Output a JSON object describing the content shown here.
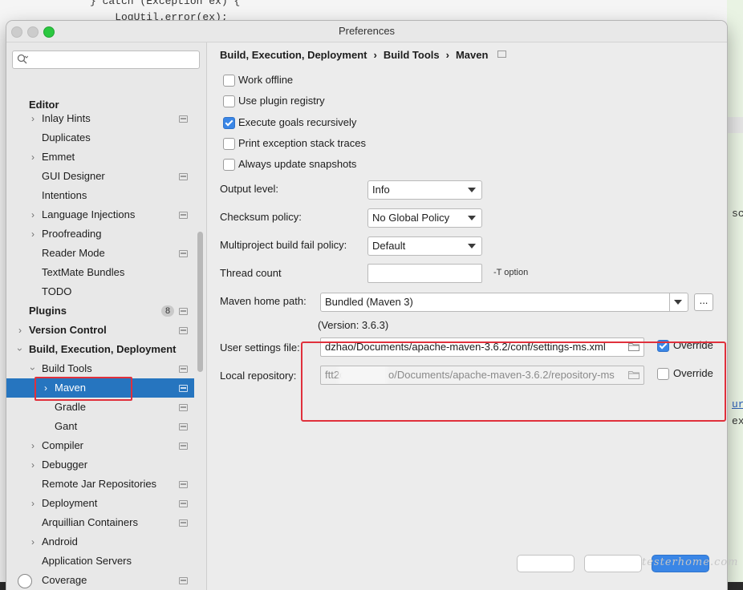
{
  "background_code": {
    "line1": "} catch (Exception ex) {",
    "line2": "    LogUtil.error(ex);",
    "right_text_1": "sc",
    "right_text_2": "ex",
    "right_link": "ur"
  },
  "window": {
    "title": "Preferences"
  },
  "search": {
    "placeholder": "",
    "value": ""
  },
  "sidebar": {
    "section_editor": "Editor",
    "items": [
      {
        "label": "Inlay Hints"
      },
      {
        "label": "Duplicates"
      },
      {
        "label": "Emmet"
      },
      {
        "label": "GUI Designer"
      },
      {
        "label": "Intentions"
      },
      {
        "label": "Language Injections"
      },
      {
        "label": "Proofreading"
      },
      {
        "label": "Reader Mode"
      },
      {
        "label": "TextMate Bundles"
      },
      {
        "label": "TODO"
      },
      {
        "label": "Plugins",
        "badge": "8"
      },
      {
        "label": "Version Control"
      },
      {
        "label": "Build, Execution, Deployment"
      },
      {
        "label": "Build Tools"
      },
      {
        "label": "Maven"
      },
      {
        "label": "Gradle"
      },
      {
        "label": "Gant"
      },
      {
        "label": "Compiler"
      },
      {
        "label": "Debugger"
      },
      {
        "label": "Remote Jar Repositories"
      },
      {
        "label": "Deployment"
      },
      {
        "label": "Arquillian Containers"
      },
      {
        "label": "Android"
      },
      {
        "label": "Application Servers"
      },
      {
        "label": "Coverage"
      }
    ]
  },
  "breadcrumb": [
    "Build, Execution, Deployment",
    "Build Tools",
    "Maven"
  ],
  "checkboxes": [
    {
      "label": "Work offline",
      "checked": false
    },
    {
      "label": "Use plugin registry",
      "checked": false
    },
    {
      "label": "Execute goals recursively",
      "checked": true
    },
    {
      "label": "Print exception stack traces",
      "checked": false
    },
    {
      "label": "Always update snapshots",
      "checked": false
    }
  ],
  "fields": {
    "output_level": {
      "label": "Output level:",
      "value": "Info"
    },
    "checksum_policy": {
      "label": "Checksum policy:",
      "value": "No Global Policy"
    },
    "fail_policy": {
      "label": "Multiproject build fail policy:",
      "value": "Default"
    },
    "thread_count": {
      "label": "Thread count",
      "value": "",
      "hint": "-T option"
    },
    "maven_home": {
      "label": "Maven home path:",
      "value": "Bundled (Maven 3)",
      "browse": "...",
      "version": "(Version: 3.6.3)"
    },
    "user_settings": {
      "label": "User settings file:",
      "value": "dzhao/Documents/apache-maven-3.6.2/conf/settings-ms.xml",
      "override_label": "Override",
      "override_checked": true
    },
    "local_repo": {
      "label": "Local repository:",
      "value_prefix": "ftt2c",
      "value": "o/Documents/apache-maven-3.6.2/repository-ms",
      "override_label": "Override",
      "override_checked": false
    }
  },
  "watermark": "testerhome.com",
  "colors": {
    "selection": "#2675bf",
    "highlight_box": "#e0303c",
    "checkbox_checked": "#3a86e6"
  }
}
